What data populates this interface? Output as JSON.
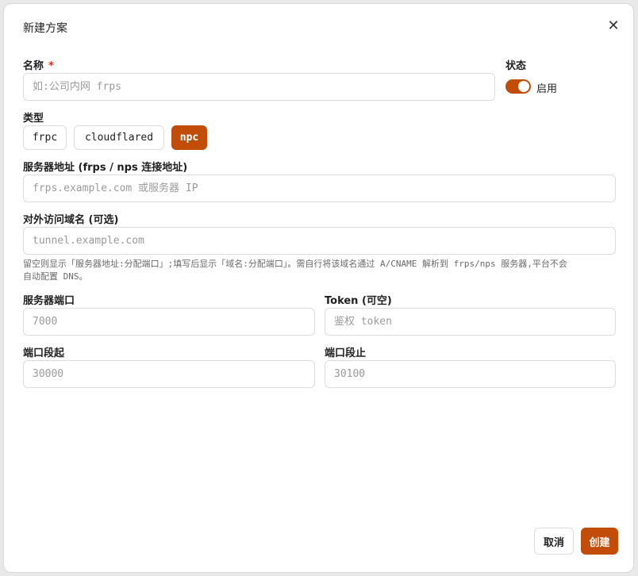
{
  "dialog": {
    "title": "新建方案",
    "close_glyph": "✕"
  },
  "fields": {
    "name_label": "名称",
    "name_required": "*",
    "name_placeholder": "如:公司内网 frps",
    "status_label": "状态",
    "status_value": "启用",
    "status_on": true,
    "type_label": "类型",
    "type_options": [
      "frpc",
      "cloudflared",
      "npc"
    ],
    "type_selected": "npc",
    "server_label": "服务器地址 (frps / nps 连接地址)",
    "server_placeholder": "frps.example.com 或服务器 IP",
    "domain_label": "对外访问域名 (可选)",
    "domain_placeholder": "tunnel.example.com",
    "domain_help_line1": "留空则显示「服务器地址:分配端口」;填写后显示「域名:分配端口」。需自行将该域名通过 A/CNAME 解析到 frps/nps 服务器,平台不会",
    "domain_help_line2": "自动配置 DNS。",
    "port_label": "服务器端口",
    "port_placeholder": "7000",
    "token_label": "Token (可空)",
    "token_placeholder": "鉴权 token",
    "port_start_label": "端口段起",
    "port_start_placeholder": "30000",
    "port_end_label": "端口段止",
    "port_end_placeholder": "30100"
  },
  "footer": {
    "cancel_label": "取消",
    "create_label": "创建"
  },
  "colors": {
    "accent": "#c14d08",
    "required": "#d93025"
  },
  "icons": {
    "close": "close-icon"
  }
}
